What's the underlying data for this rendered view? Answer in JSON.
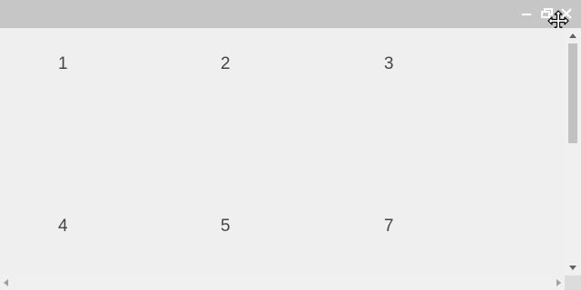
{
  "window": {
    "controls": [
      {
        "name": "minimize-button",
        "icon": "minimize-icon"
      },
      {
        "name": "restore-button",
        "icon": "restore-icon"
      },
      {
        "name": "close-button",
        "icon": "close-icon"
      }
    ],
    "cursor_icon": "move-cursor-icon"
  },
  "grid": {
    "cells": [
      "1",
      "2",
      "3",
      "4",
      "5",
      "7"
    ]
  },
  "colors": {
    "titlebar": "#c6c6c6",
    "background": "#efefef",
    "text": "#444444"
  }
}
